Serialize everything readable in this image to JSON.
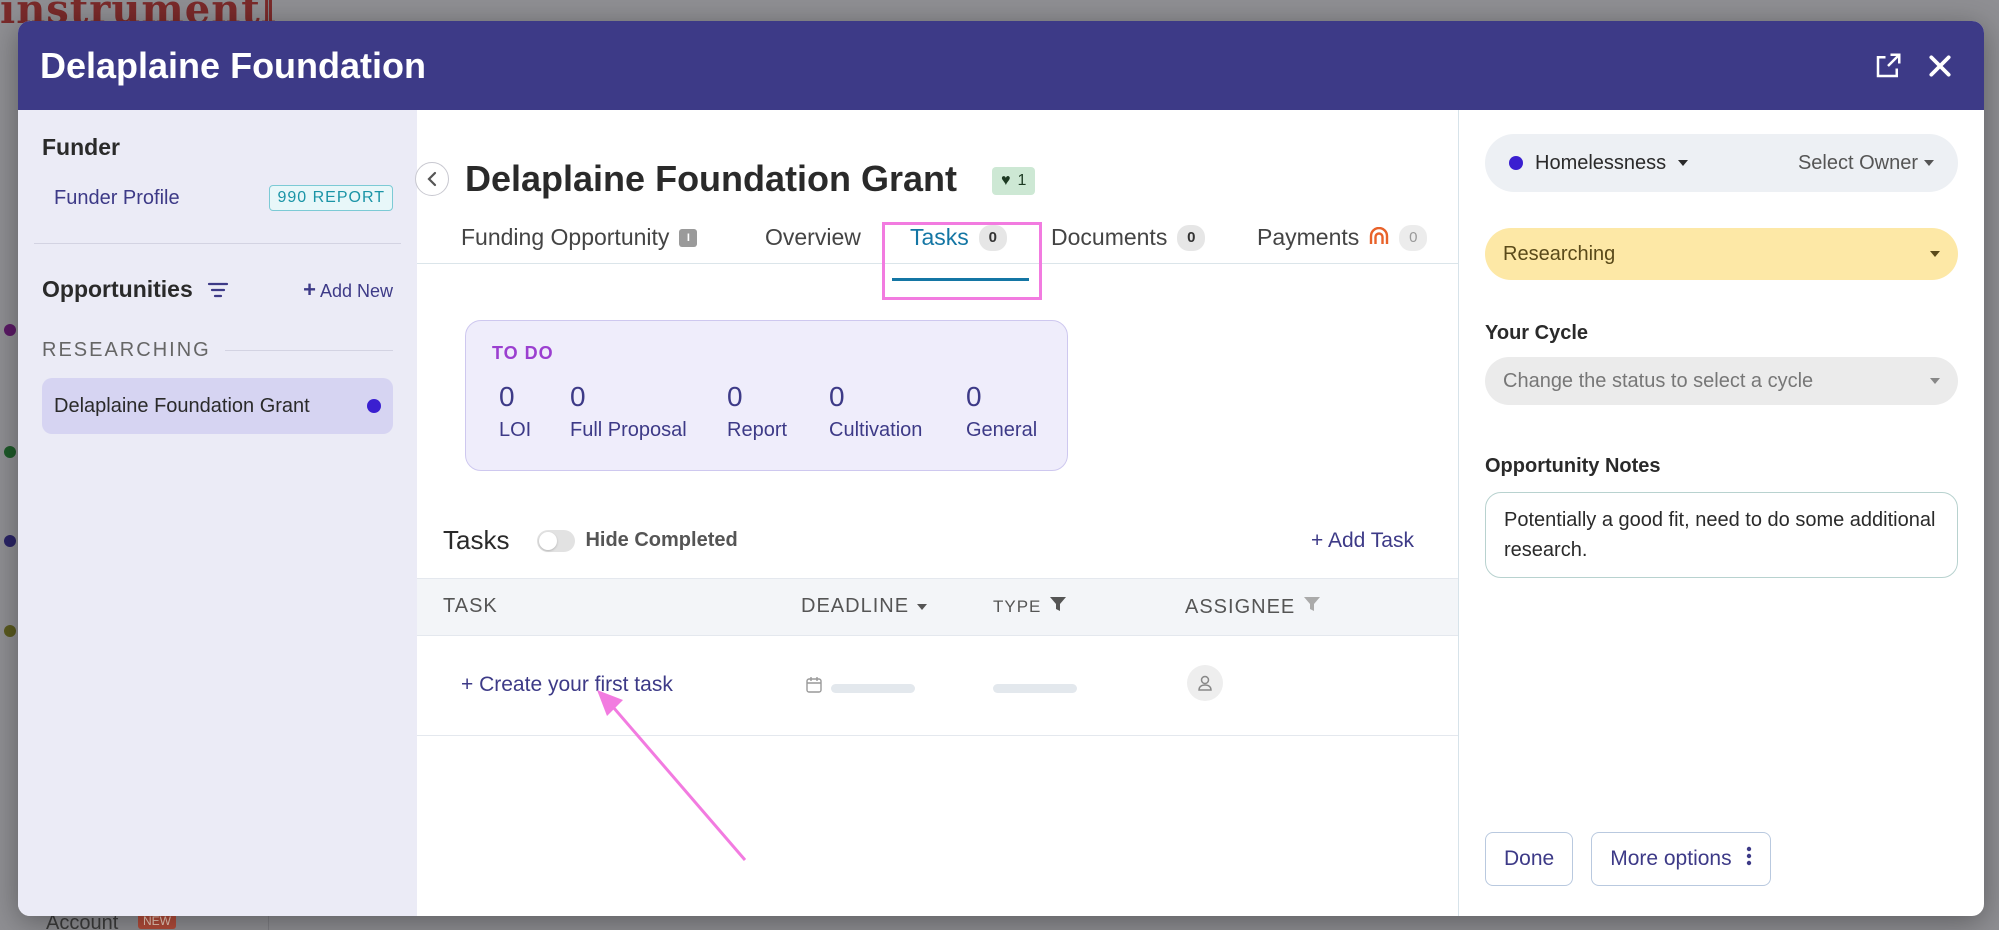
{
  "background": {
    "logo": "instrumentl",
    "account_label": "Account",
    "account_badge": "NEW"
  },
  "modal": {
    "title": "Delaplaine Foundation",
    "header_bg": "#3d3a87"
  },
  "left": {
    "funder_heading": "Funder",
    "funder_profile_link": "Funder Profile",
    "report_badge": "990 REPORT",
    "opportunities_heading": "Opportunities",
    "add_new": "Add New",
    "stage_label": "RESEARCHING",
    "opportunity_item": "Delaplaine Foundation Grant"
  },
  "main": {
    "title": "Delaplaine Foundation Grant",
    "fav_count": "1",
    "tabs": [
      {
        "label": "Funding Opportunity",
        "icon": "funding-opportunity-icon"
      },
      {
        "label": "Overview"
      },
      {
        "label": "Tasks",
        "count": "0",
        "active": true
      },
      {
        "label": "Documents",
        "count": "0"
      },
      {
        "label": "Payments",
        "count": "0",
        "icon": "payments-icon"
      }
    ],
    "todo": {
      "title": "TO DO",
      "stats": [
        {
          "num": "0",
          "label": "LOI"
        },
        {
          "num": "0",
          "label": "Full Proposal"
        },
        {
          "num": "0",
          "label": "Report"
        },
        {
          "num": "0",
          "label": "Cultivation"
        },
        {
          "num": "0",
          "label": "General"
        }
      ]
    },
    "tasks": {
      "title": "Tasks",
      "hide_completed": "Hide Completed",
      "add_task": "+ Add Task",
      "columns": {
        "task": "TASK",
        "deadline": "DEADLINE",
        "type": "TYPE",
        "assignee": "ASSIGNEE"
      },
      "create_first": "+ Create your first task"
    },
    "accent_color": "#1476a4",
    "annotation_color": "#f27be0"
  },
  "right": {
    "category": "Homelessness",
    "owner": "Select Owner",
    "status": "Researching",
    "status_color": "#fde8a6",
    "cycle_label": "Your Cycle",
    "cycle_placeholder": "Change the status to select a cycle",
    "notes_label": "Opportunity Notes",
    "notes_text": "Potentially a good fit, need to do some additional research.",
    "done_button": "Done",
    "more_options_button": "More options"
  }
}
